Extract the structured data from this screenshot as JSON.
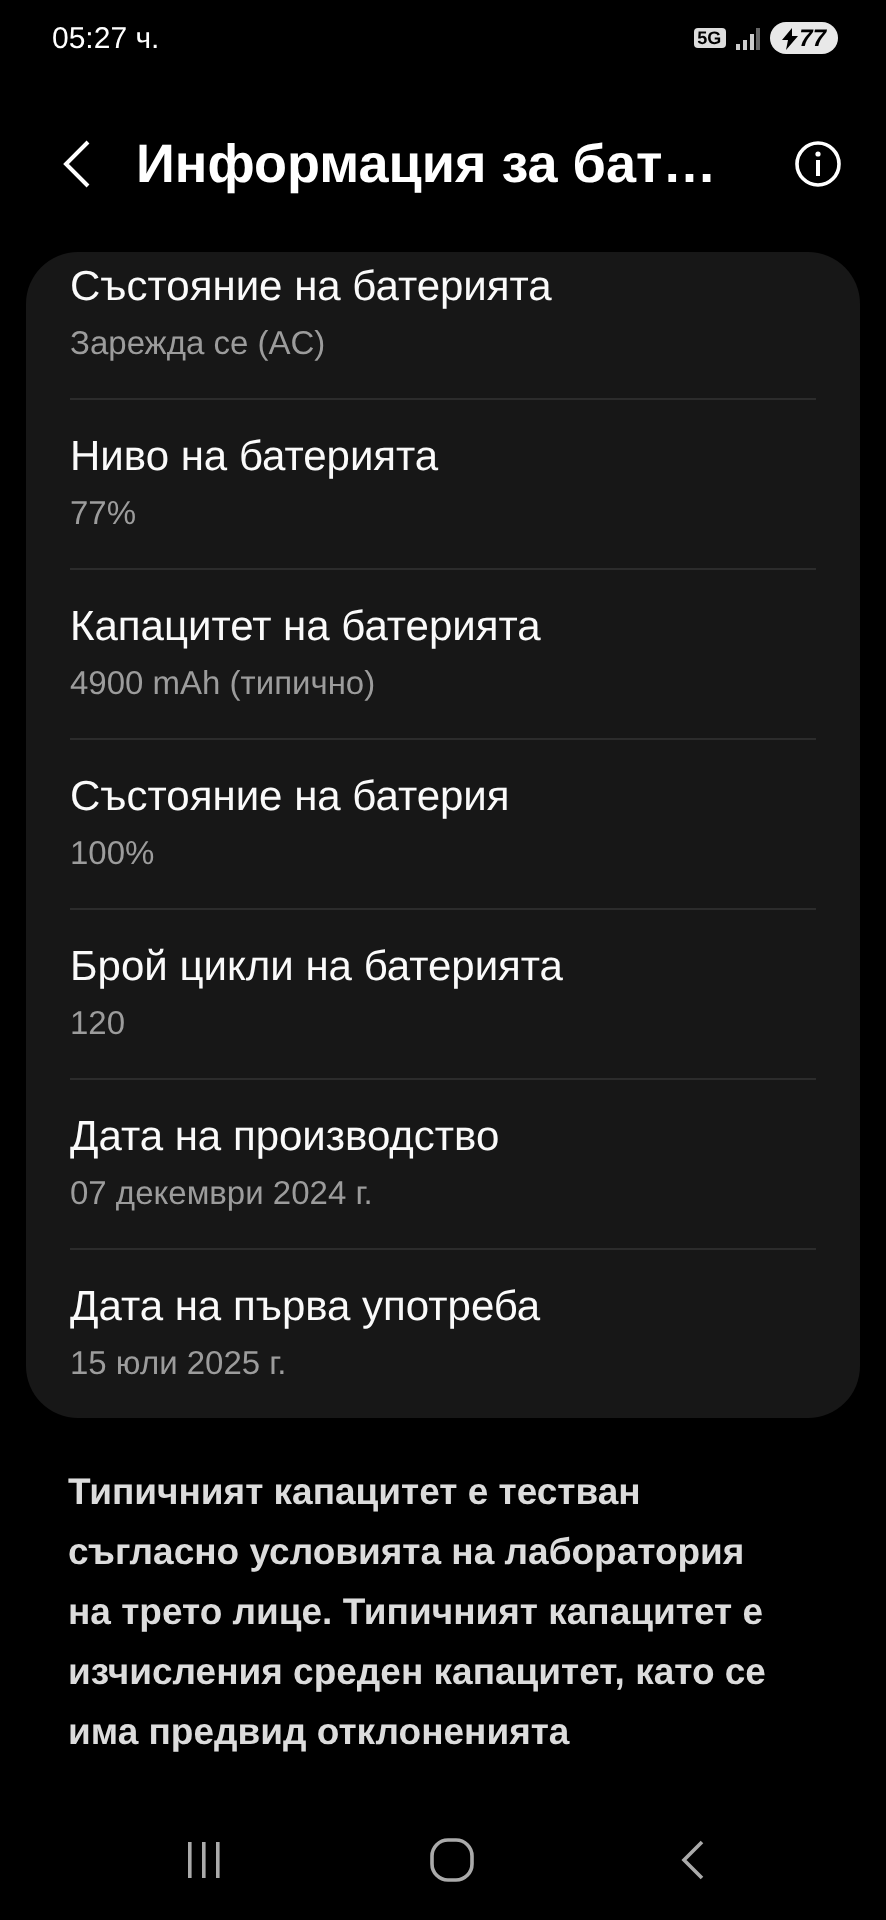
{
  "status_bar": {
    "time": "05:27 ч.",
    "network": "5G",
    "battery": "77",
    "charging": true
  },
  "header": {
    "title": "Информация за бат…"
  },
  "items": [
    {
      "title": "Състояние на батерията",
      "value": "Зарежда се (AC)"
    },
    {
      "title": "Ниво на батерията",
      "value": "77%"
    },
    {
      "title": "Капацитет на батерията",
      "value": "4900 mAh (типично)"
    },
    {
      "title": "Състояние на батерия",
      "value": "100%"
    },
    {
      "title": "Брой цикли на батерията",
      "value": "120"
    },
    {
      "title": "Дата на производство",
      "value": "07 декември 2024 г."
    },
    {
      "title": "Дата на първа употреба",
      "value": "15 юли 2025 г."
    }
  ],
  "note": "Типичният капацитет е тестван съгласно условията на лаборатория на трето лице. Типичният капацитет е изчисления среден капацитет, като се има предвид отклоненията"
}
